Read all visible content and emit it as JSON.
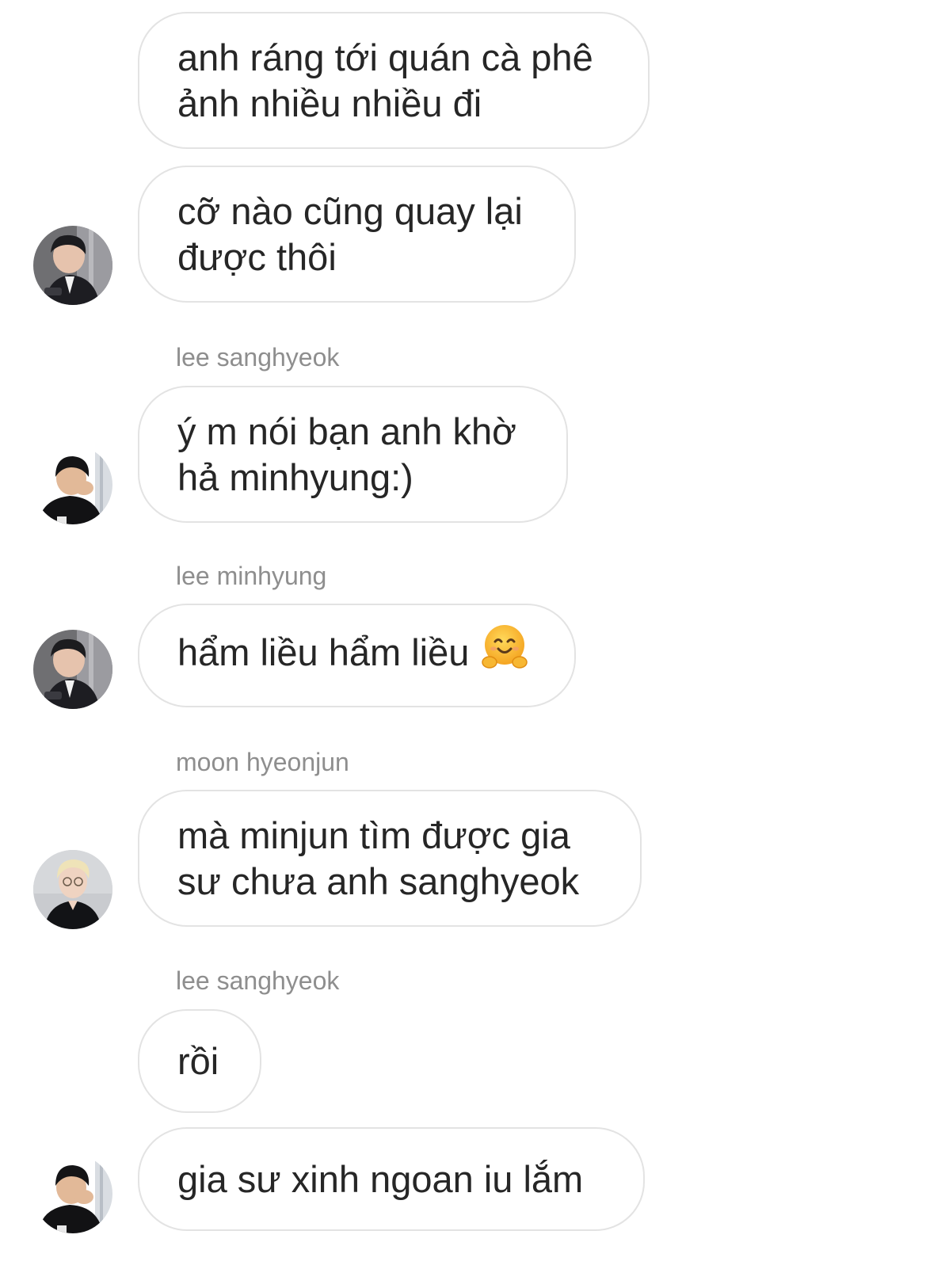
{
  "messages": [
    {
      "text": "anh ráng tới quán cà phê\nảnh nhiều nhiều đi"
    },
    {
      "text": "cỡ nào cũng quay lại\nđược thôi"
    },
    {
      "sender": "lee sanghyeok",
      "text": "ý m nói bạn anh khờ\nhả minhyung:)"
    },
    {
      "sender": "lee minhyung",
      "text": "hẩm liều hẩm liều",
      "emoji": "hugging-face-emoji"
    },
    {
      "sender": "moon hyeonjun",
      "text": "mà minjun tìm được gia\nsư chưa anh sanghyeok"
    },
    {
      "sender": "lee sanghyeok",
      "text": "rồi"
    },
    {
      "text": "gia sư xinh ngoan iu lắm"
    }
  ],
  "avatars": {
    "minhyung": "avatar-lee-minhyung",
    "sanghyeok": "avatar-lee-sanghyeok",
    "hyeonjun": "avatar-moon-hyeonjun"
  },
  "colors": {
    "bubble_border": "#e3e3e3",
    "text": "#262626",
    "sender_name": "#8e8e8e",
    "background": "#ffffff"
  }
}
